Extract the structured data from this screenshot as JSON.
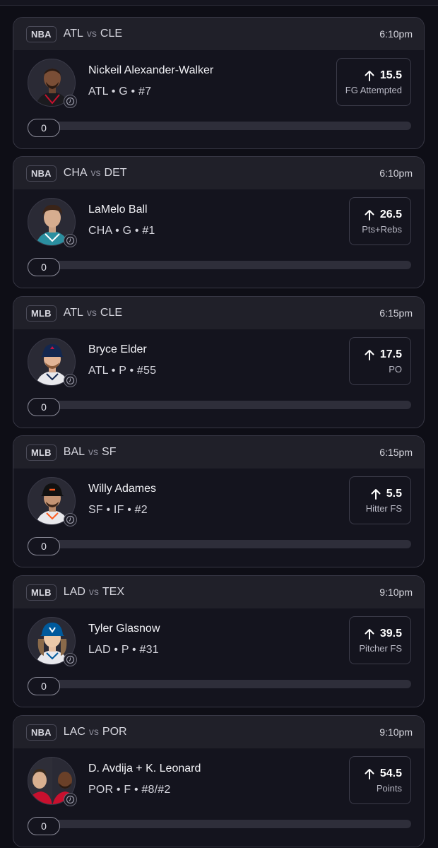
{
  "cards": [
    {
      "league": "NBA",
      "home": "ATL",
      "vs": "vs",
      "away": "CLE",
      "time": "6:10pm",
      "player_name": "Nickeil Alexander-Walker",
      "player_info": "ATL • G • #7",
      "stat_value": "15.5",
      "stat_label": "FG Attempted",
      "direction": "up-arrow-icon",
      "progress": "0",
      "jersey_color": "#1b1b1f"
    },
    {
      "league": "NBA",
      "home": "CHA",
      "vs": "vs",
      "away": "DET",
      "time": "6:10pm",
      "player_name": "LaMelo Ball",
      "player_info": "CHA • G • #1",
      "stat_value": "26.5",
      "stat_label": "Pts+Rebs",
      "direction": "up-arrow-icon",
      "progress": "0",
      "jersey_color": "#2b8fa0"
    },
    {
      "league": "MLB",
      "home": "ATL",
      "vs": "vs",
      "away": "CLE",
      "time": "6:15pm",
      "player_name": "Bryce Elder",
      "player_info": "ATL • P • #55",
      "stat_value": "17.5",
      "stat_label": "PO",
      "direction": "up-arrow-icon",
      "progress": "0",
      "jersey_color": "#e8e8ec"
    },
    {
      "league": "MLB",
      "home": "BAL",
      "vs": "vs",
      "away": "SF",
      "time": "6:15pm",
      "player_name": "Willy Adames",
      "player_info": "SF • IF • #2",
      "stat_value": "5.5",
      "stat_label": "Hitter FS",
      "direction": "up-arrow-icon",
      "progress": "0",
      "jersey_color": "#e8e8ec"
    },
    {
      "league": "MLB",
      "home": "LAD",
      "vs": "vs",
      "away": "TEX",
      "time": "9:10pm",
      "player_name": "Tyler Glasnow",
      "player_info": "LAD • P • #31",
      "stat_value": "39.5",
      "stat_label": "Pitcher FS",
      "direction": "up-arrow-icon",
      "progress": "0",
      "jersey_color": "#e8e8ec"
    },
    {
      "league": "NBA",
      "home": "LAC",
      "vs": "vs",
      "away": "POR",
      "time": "9:10pm",
      "player_name": "D. Avdija + K. Leonard",
      "player_info": "POR • F • #8/#2",
      "stat_value": "54.5",
      "stat_label": "Points",
      "direction": "up-arrow-icon",
      "progress": "0",
      "jersey_color": "#c8102e"
    }
  ]
}
